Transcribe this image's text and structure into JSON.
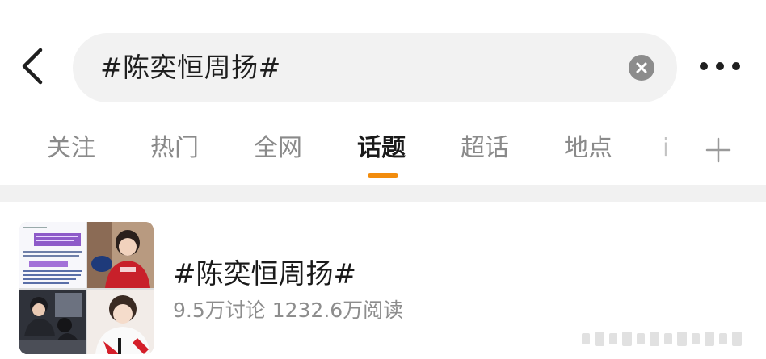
{
  "search": {
    "query": "#陈奕恒周扬#"
  },
  "tabs": [
    {
      "label": "关注",
      "active": false
    },
    {
      "label": "热门",
      "active": false
    },
    {
      "label": "全网",
      "active": false
    },
    {
      "label": "话题",
      "active": true
    },
    {
      "label": "超话",
      "active": false
    },
    {
      "label": "地点",
      "active": false
    }
  ],
  "tab_overflow_partial": "i",
  "colors": {
    "accent": "#f28c0d",
    "search_bg": "#f2f2f2",
    "divider": "#f1f1f1",
    "muted_text": "#8d8d8d"
  },
  "icons": {
    "back": "chevron-left-icon",
    "clear": "clear-x-icon",
    "more": "more-dots-icon",
    "add_tab": "plus-icon"
  },
  "result": {
    "title": "#陈奕恒周扬#",
    "stats": "9.5万讨论 1232.6万阅读"
  }
}
